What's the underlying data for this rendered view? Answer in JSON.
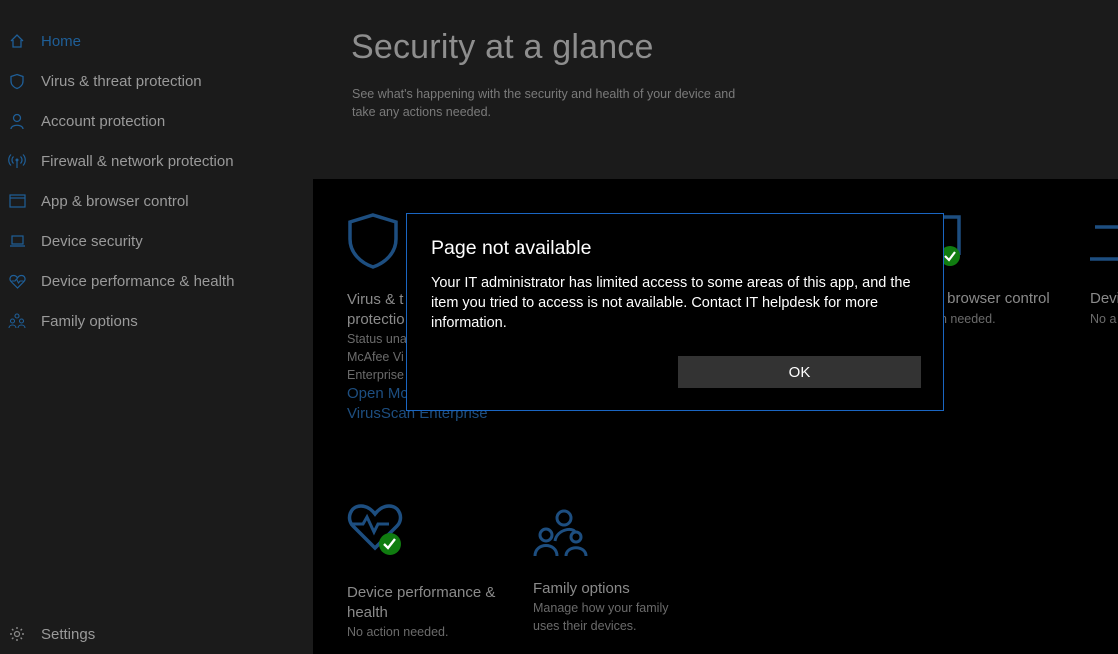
{
  "sidebar": {
    "items": [
      {
        "label": "Home",
        "icon": "home-icon",
        "active": true
      },
      {
        "label": "Virus & threat protection",
        "icon": "shield-icon"
      },
      {
        "label": "Account protection",
        "icon": "person-icon"
      },
      {
        "label": "Firewall & network protection",
        "icon": "antenna-icon"
      },
      {
        "label": "App & browser control",
        "icon": "browser-window-icon"
      },
      {
        "label": "Device security",
        "icon": "laptop-icon"
      },
      {
        "label": "Device performance & health",
        "icon": "heart-icon"
      },
      {
        "label": "Family options",
        "icon": "family-icon"
      }
    ],
    "settings_label": "Settings"
  },
  "header": {
    "title": "Security at a glance",
    "subtitle": "See what's happening with the security and health of your device and take any actions needed."
  },
  "tiles": {
    "virus": {
      "title_line1": "Virus & t",
      "title_line2": "protectio",
      "desc_line1": "Status una",
      "desc_line2": "McAfee Vi",
      "desc_line3": "Enterprise",
      "link_line1": "Open Mc",
      "link_line2": "VirusScan Enterprise"
    },
    "browser": {
      "title": "& browser control",
      "desc": "on needed."
    },
    "device_partial": {
      "title": "Devi",
      "desc": "No a"
    },
    "performance": {
      "title_line1": "Device performance &",
      "title_line2": "health",
      "desc": "No action needed."
    },
    "family": {
      "title": "Family options",
      "desc_line1": "Manage how your family",
      "desc_line2": "uses their devices."
    }
  },
  "dialog": {
    "title": "Page not available",
    "message": "Your IT administrator has limited access to some areas of this app, and the item you tried to access is not available.  Contact IT helpdesk for more information.",
    "ok_label": "OK"
  },
  "colors": {
    "accent": "#1a66c2",
    "dim_blue": "#1d4e80",
    "check_green": "#107c10"
  }
}
